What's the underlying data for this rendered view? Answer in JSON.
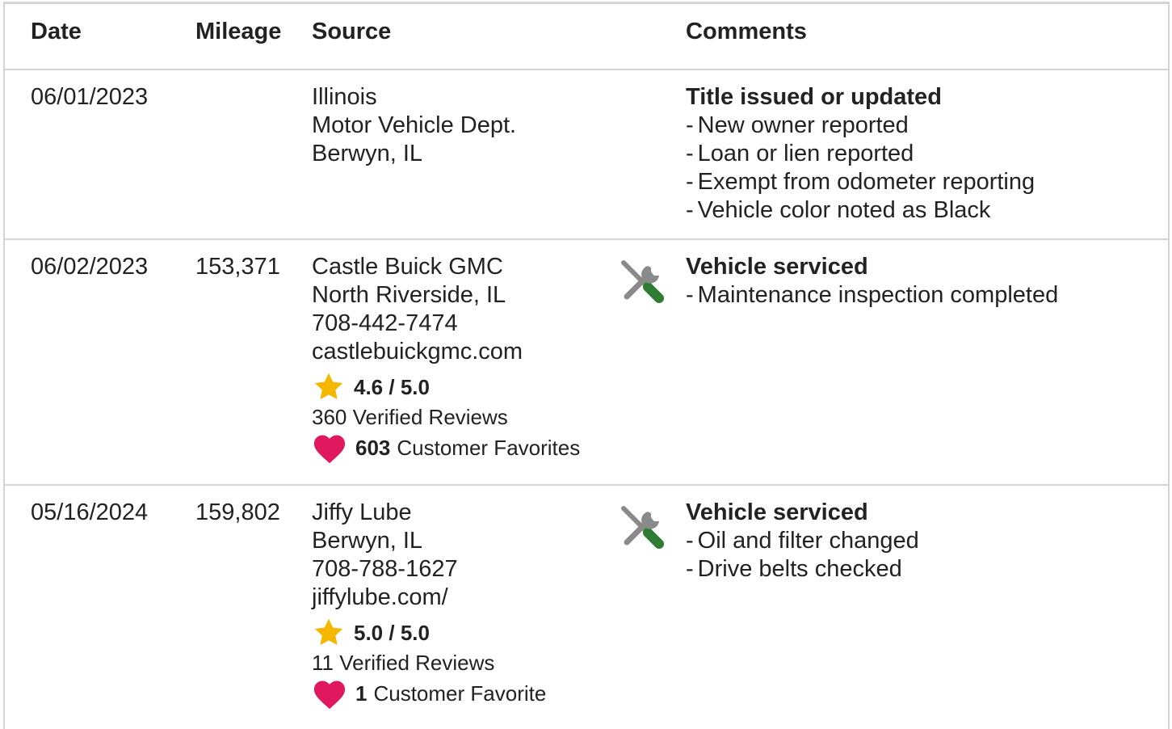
{
  "header": {
    "date": "Date",
    "mileage": "Mileage",
    "source": "Source",
    "comments": "Comments"
  },
  "records": [
    {
      "date": "06/01/2023",
      "mileage": "",
      "source": [
        "Illinois",
        "Motor Vehicle Dept.",
        "Berwyn, IL"
      ],
      "icon": null,
      "comment_title": "Title issued or updated",
      "comment_items": [
        "New owner reported",
        "Loan or lien reported",
        "Exempt from odometer reporting",
        "Vehicle color noted as Black"
      ]
    },
    {
      "date": "06/02/2023",
      "mileage": "153,371",
      "source": [
        "Castle Buick GMC",
        "North Riverside, IL",
        "708-442-7474",
        "castlebuickgmc.com"
      ],
      "rating": "4.6 / 5.0",
      "reviews": "360 Verified Reviews",
      "favorites_count": "603",
      "favorites_label": "Customer Favorites",
      "icon": "service-tools-icon",
      "comment_title": "Vehicle serviced",
      "comment_items": [
        "Maintenance inspection completed"
      ]
    },
    {
      "date": "05/16/2024",
      "mileage": "159,802",
      "source": [
        "Jiffy Lube",
        "Berwyn, IL",
        "708-788-1627",
        "jiffylube.com/"
      ],
      "rating": "5.0 / 5.0",
      "reviews": "11 Verified Reviews",
      "favorites_count": "1",
      "favorites_label": "Customer Favorite",
      "icon": "service-tools-icon",
      "comment_title": "Vehicle serviced",
      "comment_items": [
        "Oil and filter changed",
        "Drive belts checked"
      ]
    }
  ],
  "colors": {
    "border": "#d4d4d4",
    "text": "#222222",
    "star": "#f5b800",
    "heart": "#e0185e",
    "tool_gray": "#8a8a8a",
    "tool_green": "#2e7d32"
  }
}
